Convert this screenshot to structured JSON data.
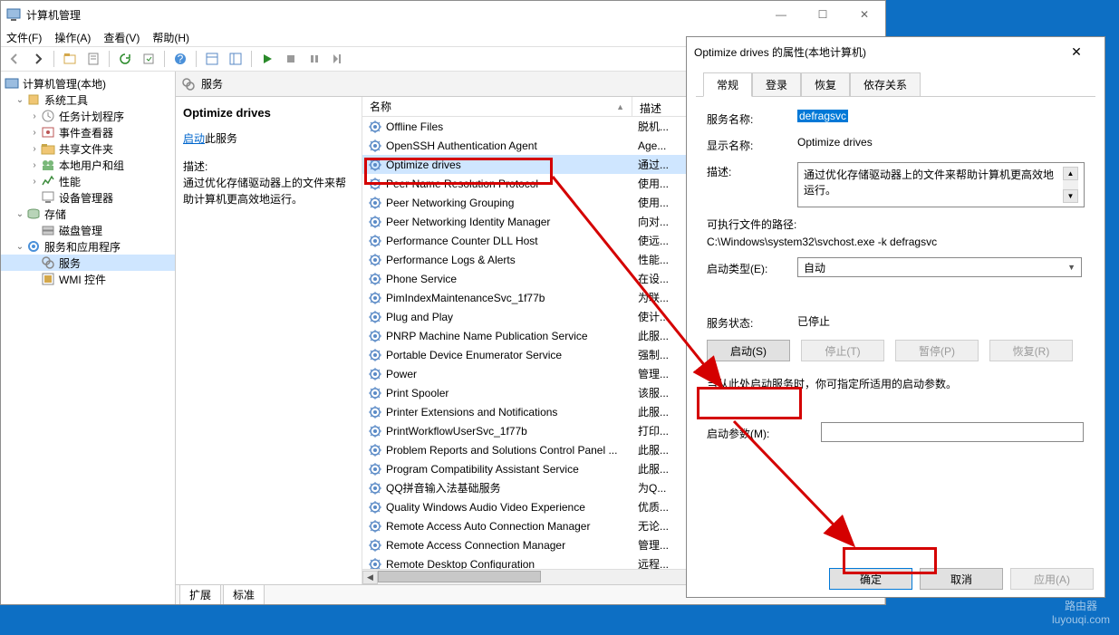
{
  "window": {
    "title": "计算机管理",
    "minimize": "—",
    "maximize": "☐",
    "close": "✕"
  },
  "menus": [
    "文件(F)",
    "操作(A)",
    "查看(V)",
    "帮助(H)"
  ],
  "tree": {
    "root": "计算机管理(本地)",
    "systools": "系统工具",
    "taskscheduler": "任务计划程序",
    "eventviewer": "事件查看器",
    "sharedfolders": "共享文件夹",
    "localusers": "本地用户和组",
    "performance": "性能",
    "devicemgr": "设备管理器",
    "storage": "存储",
    "diskmgmt": "磁盘管理",
    "servicesapps": "服务和应用程序",
    "services": "服务",
    "wmi": "WMI 控件"
  },
  "midheader": "服务",
  "listcols": {
    "name": "名称",
    "desc": "描述"
  },
  "detail": {
    "title": "Optimize drives",
    "startlinkprefix": "启动",
    "startlinksuffix": "此服务",
    "desclabel": "描述:",
    "desc": "通过优化存储驱动器上的文件来帮助计算机更高效地运行。"
  },
  "services": [
    {
      "name": "Offline Files",
      "desc": "脱机..."
    },
    {
      "name": "OpenSSH Authentication Agent",
      "desc": "Age..."
    },
    {
      "name": "Optimize drives",
      "desc": "通过...",
      "sel": true
    },
    {
      "name": "Peer Name Resolution Protocol",
      "desc": "使用..."
    },
    {
      "name": "Peer Networking Grouping",
      "desc": "使用..."
    },
    {
      "name": "Peer Networking Identity Manager",
      "desc": "向对..."
    },
    {
      "name": "Performance Counter DLL Host",
      "desc": "使远..."
    },
    {
      "name": "Performance Logs & Alerts",
      "desc": "性能..."
    },
    {
      "name": "Phone Service",
      "desc": "在设..."
    },
    {
      "name": "PimIndexMaintenanceSvc_1f77b",
      "desc": "为联..."
    },
    {
      "name": "Plug and Play",
      "desc": "使计..."
    },
    {
      "name": "PNRP Machine Name Publication Service",
      "desc": "此服..."
    },
    {
      "name": "Portable Device Enumerator Service",
      "desc": "强制..."
    },
    {
      "name": "Power",
      "desc": "管理..."
    },
    {
      "name": "Print Spooler",
      "desc": "该服..."
    },
    {
      "name": "Printer Extensions and Notifications",
      "desc": "此服..."
    },
    {
      "name": "PrintWorkflowUserSvc_1f77b",
      "desc": "打印..."
    },
    {
      "name": "Problem Reports and Solutions Control Panel ...",
      "desc": "此服..."
    },
    {
      "name": "Program Compatibility Assistant Service",
      "desc": "此服..."
    },
    {
      "name": "QQ拼音输入法基础服务",
      "desc": "为Q..."
    },
    {
      "name": "Quality Windows Audio Video Experience",
      "desc": "优质..."
    },
    {
      "name": "Remote Access Auto Connection Manager",
      "desc": "无论..."
    },
    {
      "name": "Remote Access Connection Manager",
      "desc": "管理..."
    },
    {
      "name": "Remote Desktop Configuration",
      "desc": "远程..."
    }
  ],
  "bottomtabs": {
    "ext": "扩展",
    "std": "标准"
  },
  "prop": {
    "title": "Optimize drives 的属性(本地计算机)",
    "close": "✕",
    "tabs": {
      "general": "常规",
      "logon": "登录",
      "recovery": "恢复",
      "deps": "依存关系"
    },
    "svcname_lbl": "服务名称:",
    "svcname_val": "defragsvc",
    "dispname_lbl": "显示名称:",
    "dispname_val": "Optimize drives",
    "desc_lbl": "描述:",
    "desc_val": "通过优化存储驱动器上的文件来帮助计算机更高效地运行。",
    "exepath_lbl": "可执行文件的路径:",
    "exepath_val": "C:\\Windows\\system32\\svchost.exe -k defragsvc",
    "starttype_lbl": "启动类型(E):",
    "starttype_val": "自动",
    "status_lbl": "服务状态:",
    "status_val": "已停止",
    "btn_start": "启动(S)",
    "btn_stop": "停止(T)",
    "btn_pause": "暂停(P)",
    "btn_resume": "恢复(R)",
    "hint": "当从此处启动服务时，你可指定所适用的启动参数。",
    "params_lbl": "启动参数(M):",
    "btn_ok": "确定",
    "btn_cancel": "取消",
    "btn_apply": "应用(A)"
  },
  "watermark": {
    "brand": "路由器",
    "domain": "luyouqi.com"
  }
}
